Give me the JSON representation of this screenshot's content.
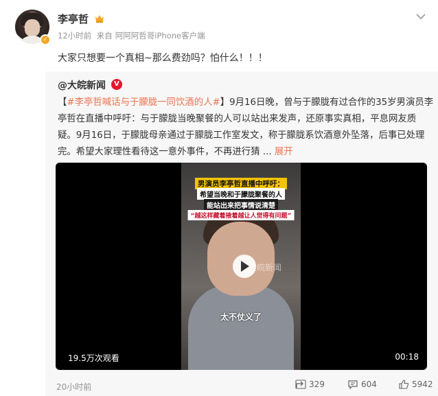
{
  "author": {
    "name": "李亭哲",
    "meta": {
      "time": "12小时前",
      "source_prefix": "来自",
      "source": "阿阿阿哲哥iPhone客户端"
    },
    "text": "大家只想要一个真相~那么费劲吗？怕什么！！！"
  },
  "repost": {
    "author": "@大皖新闻",
    "topic": "#李亭哲喊话与于朦胧一同饮酒的人#",
    "bracket_open": "【",
    "bracket_close": "】",
    "body": "9月16日晚，曾与于朦胧有过合作的35岁男演员李亭哲在直播中呼吁：与于朦胧当晚聚餐的人可以站出来发声，还原事实真相，平息网友质疑。9月16日，于朦胧母亲通过于朦胧工作室发文，称于朦胧系饮酒意外坠落，后事已处理完。希望大家理性看待这一意外事件，不再进行猜 ...",
    "expand_label": "展开",
    "video": {
      "caption_1": "男演员李亭哲直播中呼吁：",
      "caption_2": "希望当晚和于朦胧聚餐的人",
      "caption_3": "能站出来把事情说清楚",
      "caption_4": "“越这样藏着掖着越让人觉得有问题”",
      "watermark": "大皖新闻",
      "subtitle": "太不仗义了",
      "views": "19.5万次观看",
      "duration": "00:18"
    },
    "time": "20小时前",
    "actions": {
      "share_count": "329",
      "comment_count": "604",
      "like_count": "5942"
    }
  }
}
